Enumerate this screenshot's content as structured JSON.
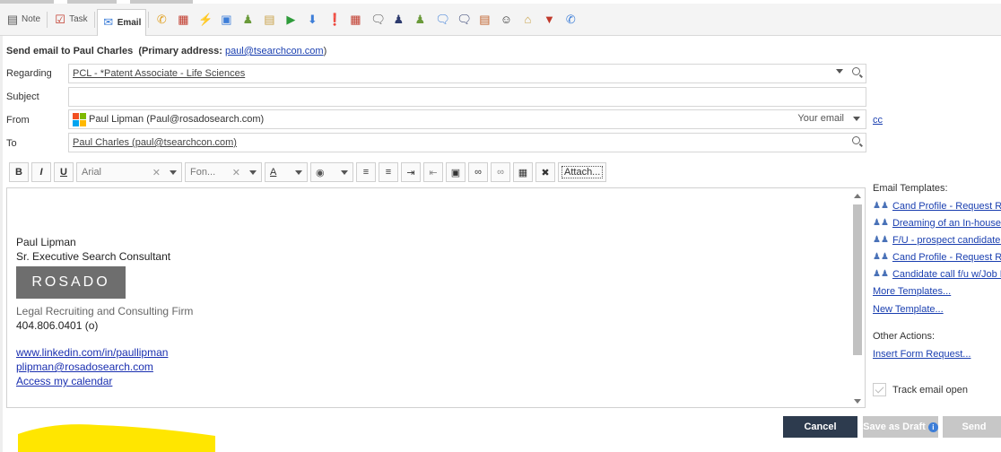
{
  "toolbar": {
    "note_label": "Note",
    "task_label": "Task",
    "email_label": "Email"
  },
  "header": {
    "prefix": "Send email to Paul Charles",
    "primary_label": "(Primary address:",
    "primary_email": "paul@tsearchcon.com",
    "suffix": ")"
  },
  "form": {
    "regarding_label": "Regarding",
    "regarding_value": "PCL - *Patent Associate - Life Sciences",
    "subject_label": "Subject",
    "subject_value": "",
    "from_label": "From",
    "from_value": "Paul Lipman (Paul@rosadosearch.com)",
    "from_type": "Your email",
    "cc_label": "cc",
    "to_label": "To",
    "to_value": "Paul Charles (paul@tsearchcon.com)"
  },
  "editor_toolbar": {
    "bold": "B",
    "italic": "I",
    "underline": "U",
    "font_family": "Arial",
    "font_size": "Fon...",
    "font_color_glyph": "A",
    "attach_label": "Attach..."
  },
  "signature": {
    "name": "Paul Lipman",
    "title": "Sr. Executive Search Consultant",
    "logo_text": "ROSADO",
    "firm": "Legal Recruiting and Consulting Firm",
    "phone": "404.806.0401 (o)",
    "linkedin": "www.linkedin.com/in/paullipman",
    "email": "plipman@rosadosearch.com",
    "calendar": "Access my calendar"
  },
  "sidebar": {
    "templates_title": "Email Templates:",
    "templates": [
      "Cand Profile - Request Res",
      "Dreaming of an In-house r",
      "F/U - prospect candidate i",
      "Cand Profile - Request Res",
      "Candidate call f/u w/Job D"
    ],
    "more_templates": "More Templates...",
    "new_template": "New Template...",
    "other_actions_title": "Other Actions:",
    "insert_form": "Insert Form Request...",
    "track_label": "Track email open"
  },
  "actions": {
    "cancel": "Cancel",
    "save_draft": "Save as Draft",
    "send": "Send"
  },
  "colors": {
    "cancel_bg": "#2d3b4e",
    "link": "#1a3fb0",
    "highlight": "#ffe600"
  }
}
